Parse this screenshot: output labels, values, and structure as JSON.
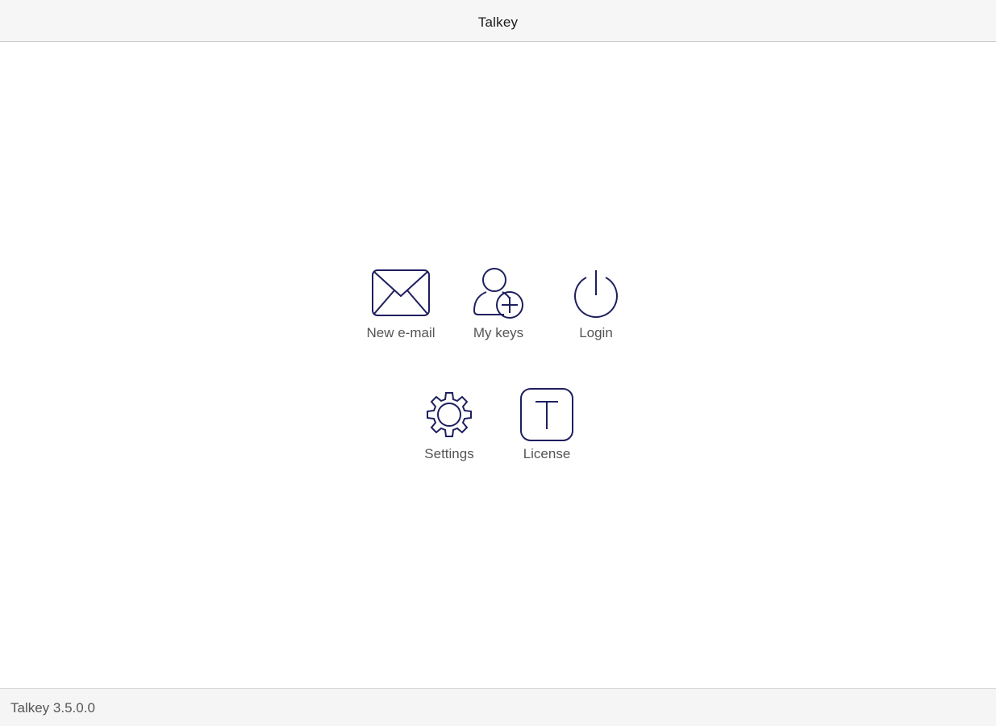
{
  "window": {
    "title": "Talkey"
  },
  "menu": {
    "items": [
      {
        "label": "New e-mail",
        "icon": "envelope-icon"
      },
      {
        "label": "My keys",
        "icon": "user-add-icon"
      },
      {
        "label": "Login",
        "icon": "power-icon"
      },
      {
        "label": "Settings",
        "icon": "gear-icon"
      },
      {
        "label": "License",
        "icon": "license-t-icon"
      }
    ]
  },
  "footer": {
    "version": "Talkey 3.5.0.0"
  },
  "colors": {
    "icon_stroke": "#1e1f5e",
    "label_text": "#555555",
    "bar_background": "#f5f5f5"
  }
}
